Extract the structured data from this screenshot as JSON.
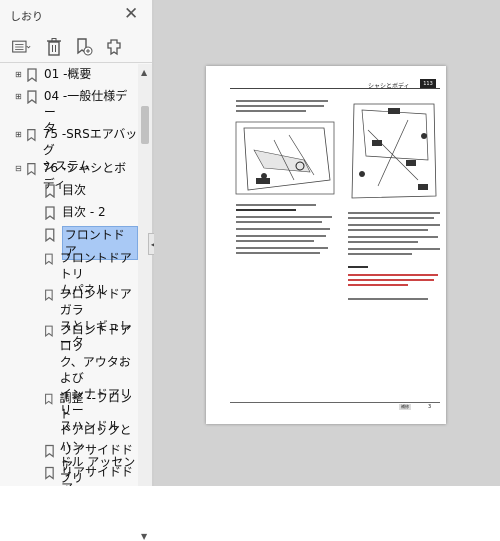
{
  "sidebar": {
    "title": "しおり",
    "close_glyph": "✕",
    "toolbar": [
      {
        "name": "options-menu-button",
        "icon": "list-options-icon"
      },
      {
        "name": "delete-bookmark-button",
        "icon": "trash-icon"
      },
      {
        "name": "new-bookmark-button",
        "icon": "new-bookmark-icon"
      },
      {
        "name": "expand-bookmark-button",
        "icon": "bookmark-tag-icon"
      }
    ],
    "bookmarks": [
      {
        "label": "01 -概要",
        "expander": "plus"
      },
      {
        "label": "04 -一般仕様デー",
        "label2": "タ",
        "expander": "plus"
      },
      {
        "label": "75 -SRSエアバッグ",
        "label2": "システム",
        "expander": "plus"
      },
      {
        "label": "76 -シャシとボディ",
        "expander": "minus"
      },
      {
        "label": "目次"
      },
      {
        "label": "目次 - 2"
      },
      {
        "label": "フロントドア",
        "selected": true
      },
      {
        "label": "フロントドアトリ",
        "label2": "ムパネル"
      },
      {
        "label": "フロントドアガラ",
        "label2": "スとレギュレータ"
      },
      {
        "label": "フロントドアロッ",
        "label2": "ク、アウタおよび",
        "label3": "インナドアリリー",
        "label4": "スハンドル"
      },
      {
        "label": "調整 --フロント",
        "label2": "ドアロックとハン",
        "label3": "ドル アッセンブリ"
      },
      {
        "label": "リアサイドドア"
      },
      {
        "label": "リアサイドドア"
      }
    ],
    "collapse_glyph": "◀"
  },
  "document": {
    "header_title": "シャシとボディ",
    "header_badge": "113",
    "page_number": "3",
    "footer_label": "補修"
  },
  "colors": {
    "selected_bg": "#a9c9f5",
    "viewer_bg": "#d2d2d2"
  }
}
